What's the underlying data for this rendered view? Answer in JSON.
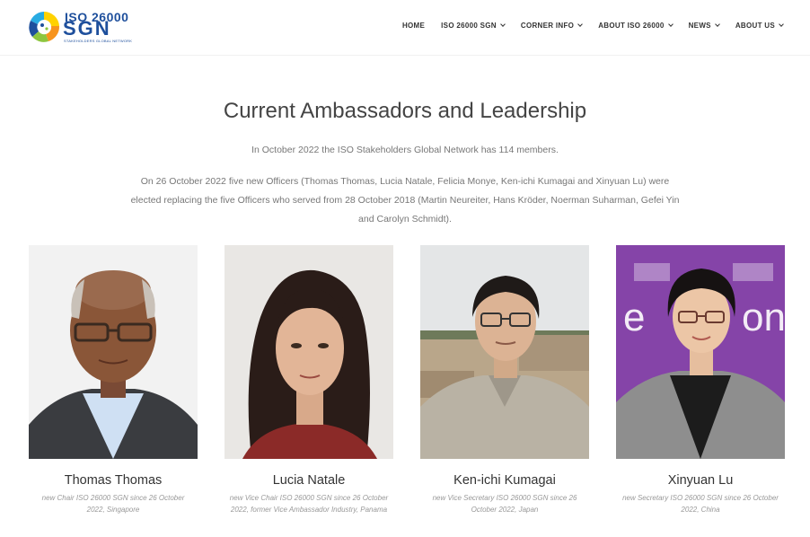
{
  "header": {
    "logo": {
      "top_text": "ISO 26000",
      "big_text": "SGN",
      "sub_text": "STAKEHOLDERS GLOBAL NETWORK"
    },
    "nav": [
      {
        "label": "HOME",
        "has_dropdown": false
      },
      {
        "label": "ISO 26000 SGN",
        "has_dropdown": true
      },
      {
        "label": "CORNER INFO",
        "has_dropdown": true
      },
      {
        "label": "ABOUT ISO 26000",
        "has_dropdown": true
      },
      {
        "label": "NEWS",
        "has_dropdown": true
      },
      {
        "label": "ABOUT US",
        "has_dropdown": true
      }
    ]
  },
  "main": {
    "title": "Current Ambassadors and Leadership",
    "intro": "In October 2022 the ISO Stakeholders Global Network has 114 members.",
    "paragraph": "On 26 October 2022 five new Officers (Thomas Thomas, Lucia Natale, Felicia Monye, Ken-ichi Kumagai and Xinyuan Lu) were elected replacing the five Officers  who served from 28 October 2018 (Martin Neureiter, Hans Kröder, Noerman Suharman, Gefei Yin and Carolyn Schmidt).",
    "people": [
      {
        "name": "Thomas Thomas",
        "caption": "new Chair ISO 26000 SGN since 26 October 2022, Singapore"
      },
      {
        "name": "Lucia Natale",
        "caption": "new Vice Chair ISO 26000 SGN since 26 October 2022, former Vice Ambassador Industry, Panama"
      },
      {
        "name": "Ken-ichi Kumagai",
        "caption": "new Vice Secretary ISO 26000 SGN since 26 October 2022, Japan"
      },
      {
        "name": "Xinyuan Lu",
        "caption": "new Secretary ISO 26000 SGN since 26 October 2022, China"
      }
    ]
  },
  "colors": {
    "brand": "#1e4f9c",
    "logo_green": "#8dc63f",
    "logo_orange": "#f7941d",
    "logo_blue": "#29abe2"
  }
}
